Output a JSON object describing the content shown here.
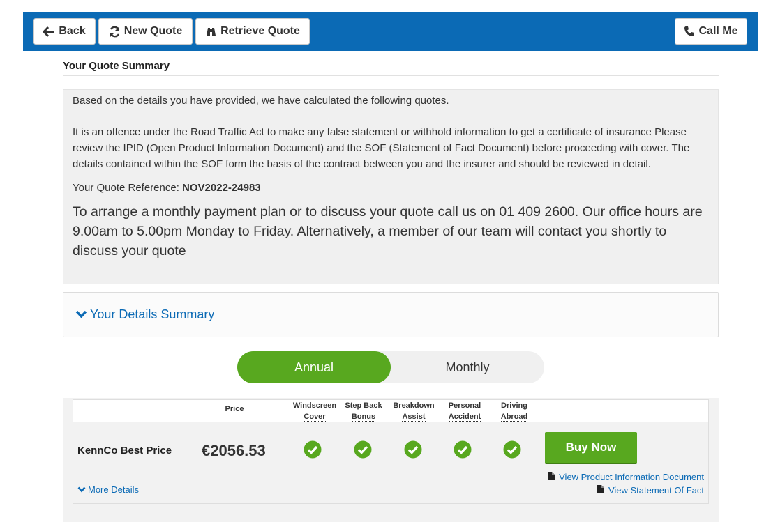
{
  "toolbar": {
    "back_label": "Back",
    "new_quote_label": "New Quote",
    "retrieve_quote_label": "Retrieve Quote",
    "call_me_label": "Call Me"
  },
  "summary": {
    "title": "Your Quote Summary",
    "intro": "Based on the details you have provided, we have calculated the following quotes.",
    "warning": "It is an offence under the Road Traffic Act to make any false statement or withhold information to get a certificate of insurance Please review the IPID (Open Product Information Document) and the SOF (Statement of Fact Document) before proceeding with cover. The details contained within the SOF form the basis of the contract between you and the insurer and should be reviewed in detail.",
    "reference_label": "Your Quote Reference: ",
    "reference_value": "NOV2022-24983",
    "contact_text": "To arrange a monthly payment plan or to discuss your quote call us on 01 409 2600. Our office hours are 9.00am to 5.00pm Monday to Friday. Alternatively, a member of our team will contact you shortly to discuss your quote"
  },
  "details_summary": {
    "label": "Your Details Summary"
  },
  "payment_toggle": {
    "annual": "Annual",
    "monthly": "Monthly",
    "selected": "Annual"
  },
  "quote_table": {
    "headers": {
      "price": "Price",
      "windscreen_line1": "Windscreen",
      "windscreen_line2": "Cover",
      "stepback_line1": "Step Back",
      "stepback_line2": "Bonus",
      "breakdown_line1": "Breakdown",
      "breakdown_line2": "Assist",
      "personal_line1": "Personal",
      "personal_line2": "Accident",
      "driving_line1": "Driving",
      "driving_line2": "Abroad"
    },
    "rows": [
      {
        "provider": "KennCo Best Price",
        "price": "€2056.53",
        "buy_label": "Buy Now",
        "more_details": "More Details",
        "ipid_link": "View Product Information Document",
        "sof_link": "View Statement Of Fact"
      }
    ]
  },
  "colors": {
    "brand_blue": "#0b6ab5",
    "accent_green": "#58a81f"
  },
  "icons": [
    "arrow-left-icon",
    "refresh-icon",
    "binoculars-icon",
    "phone-icon",
    "chevron-down-icon",
    "check-circle-icon",
    "document-icon"
  ]
}
